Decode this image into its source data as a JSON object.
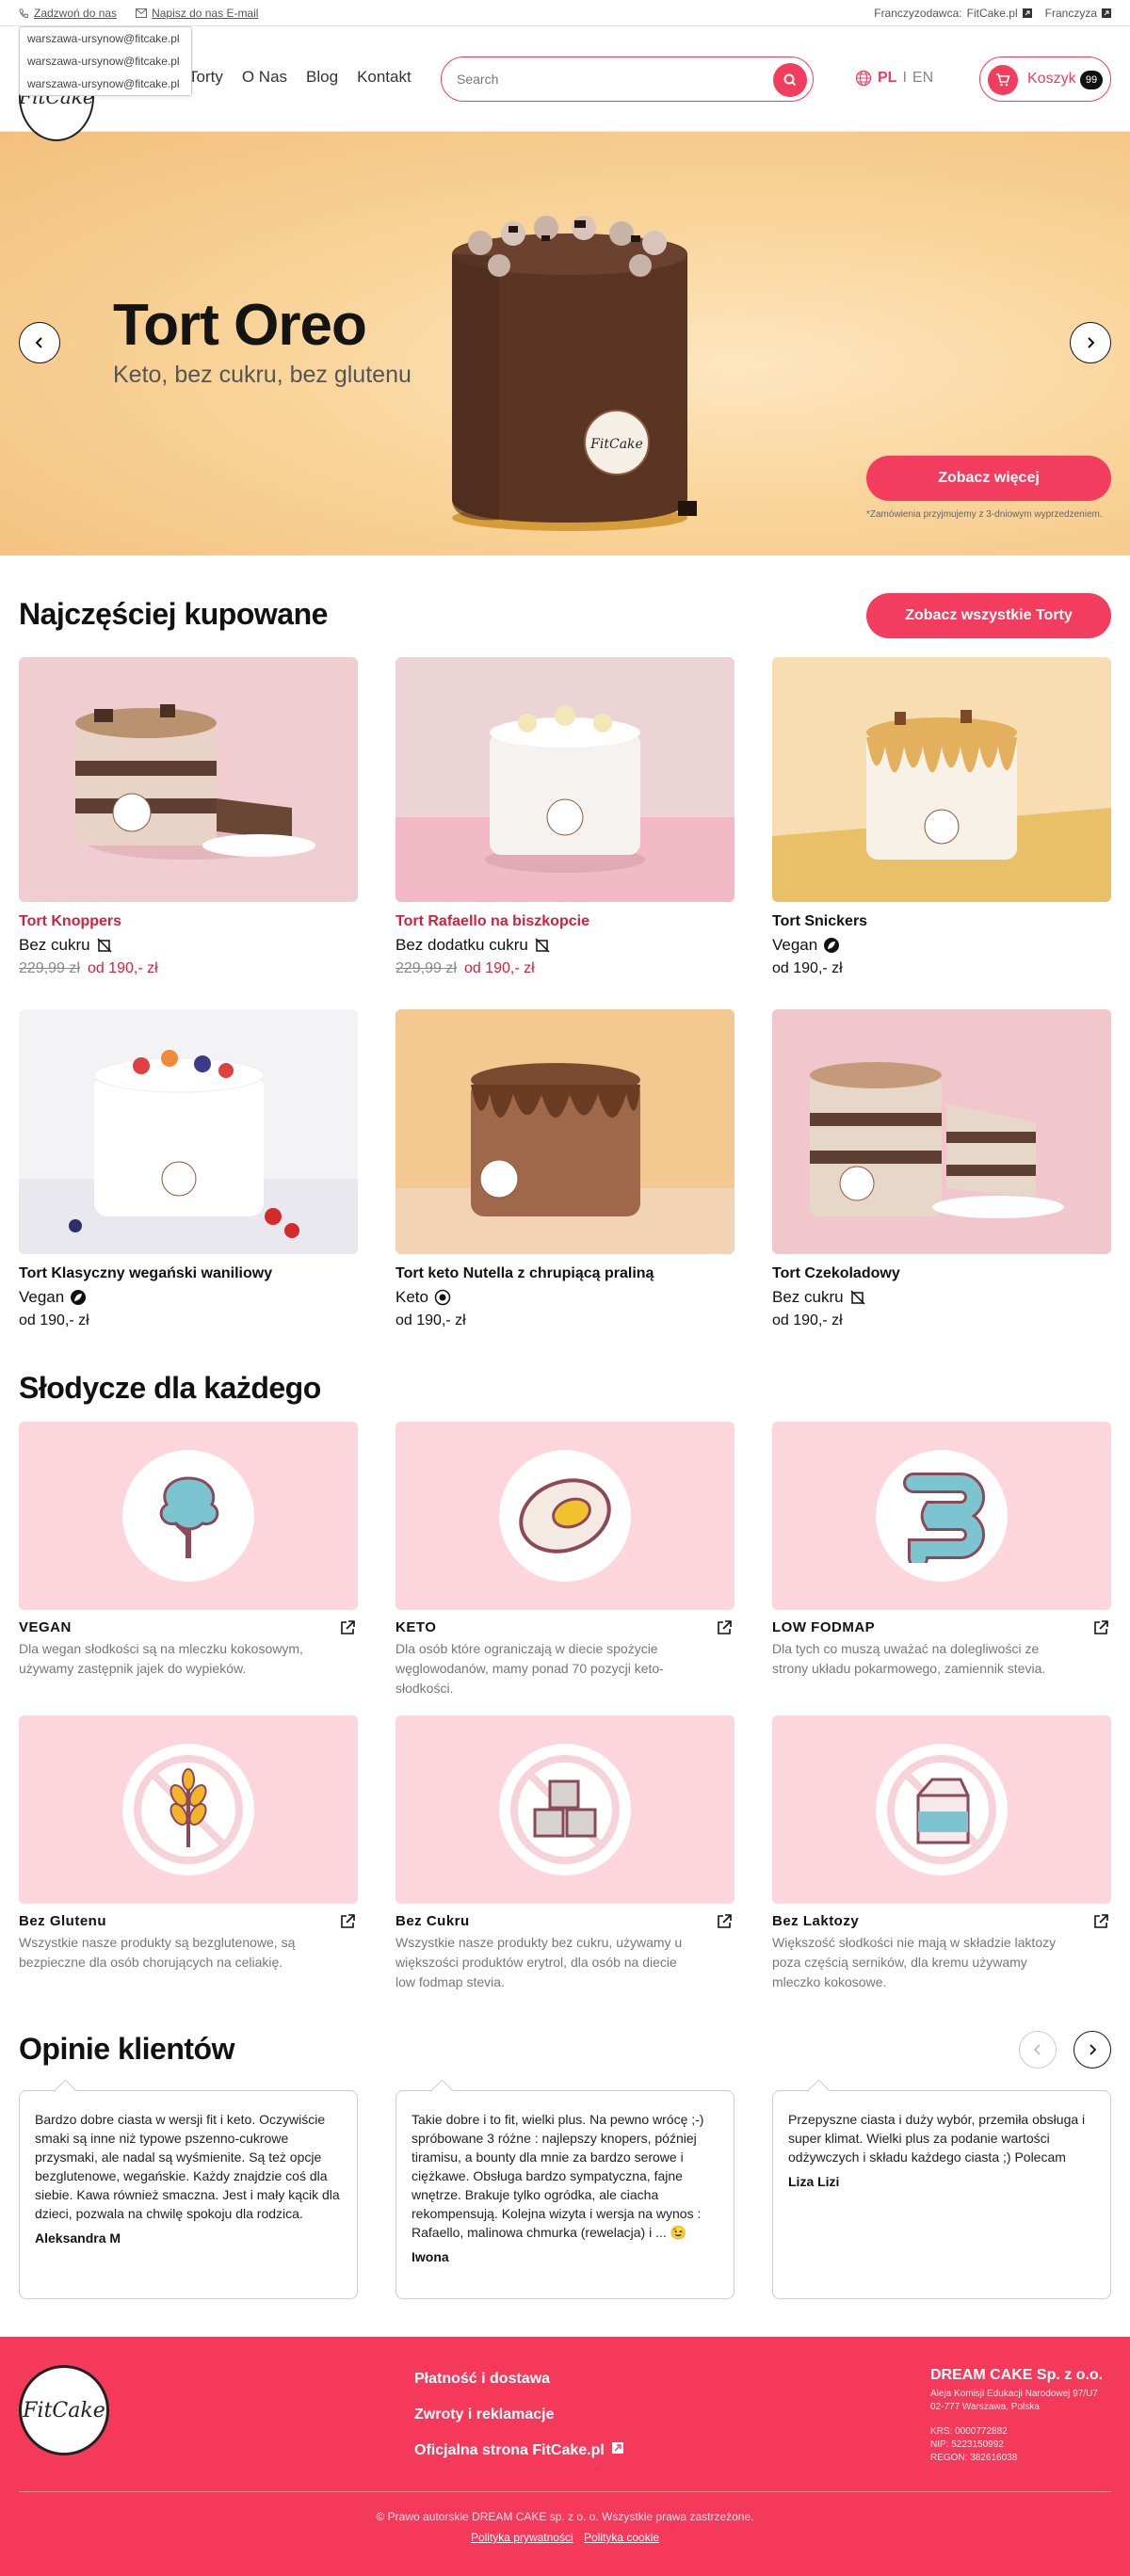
{
  "topbar": {
    "call": "Zadzwoń do nas",
    "email": "Napisz do nas E-mail",
    "franchisor_label": "Franczyzodawca:",
    "franchisor_link": "FitCake.pl",
    "franchise": "Franczyza",
    "dropdown": [
      "warszawa-ursynow@fitcake.pl",
      "warszawa-ursynow@fitcake.pl",
      "warszawa-ursynow@fitcake.pl"
    ]
  },
  "header": {
    "logo": "FitCake",
    "nav": [
      "Torty",
      "O Nas",
      "Blog",
      "Kontakt"
    ],
    "search_placeholder": "Search",
    "lang_active": "PL",
    "lang_sep": "I",
    "lang_other": "EN",
    "cart_label": "Koszyk",
    "cart_count": "99"
  },
  "hero": {
    "title": "Tort Oreo",
    "subtitle": "Keto, bez cukru, bez glutenu",
    "cta": "Zobacz więcej",
    "note": "*Zamówienia przyjmujemy z 3-dniowym wyprzedzeniem."
  },
  "popular": {
    "title": "Najczęściej kupowane",
    "cta": "Zobacz wszystkie Torty",
    "products": [
      {
        "name": "Tort Knoppers",
        "tag": "Bez cukru",
        "old_price": "229,99 zł",
        "price": "od 190,- zł"
      },
      {
        "name": "Tort Rafaello na biszkopcie",
        "tag": "Bez dodatku cukru",
        "old_price": "229,99 zł",
        "price": "od 190,- zł"
      },
      {
        "name": "Tort Snickers",
        "tag": "Vegan",
        "old_price": "",
        "price": "od 190,- zł"
      },
      {
        "name": "Tort Klasyczny wegański waniliowy",
        "tag": "Vegan",
        "old_price": "",
        "price": "od 190,- zł"
      },
      {
        "name": "Tort keto Nutella z chrupiącą praliną",
        "tag": "Keto",
        "old_price": "",
        "price": "od 190,- zł"
      },
      {
        "name": "Tort Czekoladowy",
        "tag": "Bez cukru",
        "old_price": "",
        "price": "od 190,- zł"
      }
    ]
  },
  "categories": {
    "title": "Słodycze dla każdego",
    "items": [
      {
        "title": "VEGAN",
        "desc": "Dla wegan słodkości są na mleczku kokosowym, używamy zastępnik jajek do wypieków."
      },
      {
        "title": "KETO",
        "desc": "Dla osób które ograniczają w diecie spożycie węglowodanów, mamy ponad 70 pozycji keto-słodkości."
      },
      {
        "title": "LOW FODMAP",
        "desc": "Dla tych co muszą uważać na dolegliwości ze strony układu pokarmowego, zamiennik stevia."
      },
      {
        "title": "Bez Glutenu",
        "desc": "Wszystkie nasze produkty są bezglutenowe, są bezpieczne dla osób chorujących na celiakię."
      },
      {
        "title": "Bez Cukru",
        "desc": "Wszystkie nasze produkty bez cukru, używamy u większości produktów erytrol, dla osób na diecie low fodmap stevia."
      },
      {
        "title": "Bez Laktozy",
        "desc": "Większość słodkości nie mają w składzie laktozy poza częścią serników, dla kremu używamy mleczko kokosowe."
      }
    ]
  },
  "reviews": {
    "title": "Opinie klientów",
    "items": [
      {
        "text": "Bardzo dobre ciasta w wersji fit i keto. Oczywiście smaki są inne niż typowe pszenno-cukrowe przysmaki, ale nadal są wyśmienite. Są też opcje bezglutenowe, wegańskie. Każdy znajdzie coś dla siebie. Kawa również smaczna. Jest i mały kącik dla dzieci, pozwala na chwilę spokoju dla rodzica.",
        "author": "Aleksandra M"
      },
      {
        "text": "Takie dobre i to fit, wielki plus. Na pewno wrócę ;-) spróbowane 3 różne : najlepszy knopers, później tiramisu, a bounty dla mnie za bardzo serowe i ciężkawe. Obsługa bardzo sympatyczna, fajne wnętrze. Brakuje tylko ogródka, ale ciacha rekompensują. Kolejna wizyta i wersja na wynos : Rafaello, malinowa chmurka (rewelacja) i ... 😉",
        "author": "Iwona"
      },
      {
        "text": "Przepyszne ciasta i duży wybór, przemiła obsługa i super klimat.  Wielki plus za podanie wartości odżywczych i składu każdego ciasta ;) Polecam",
        "author": "Liza Lizi"
      }
    ]
  },
  "footer": {
    "logo": "FitCake",
    "links": [
      "Płatność i dostawa",
      "Zwroty i reklamacje",
      "Oficjalna strona FitCake.pl"
    ],
    "company": "DREAM CAKE Sp. z o.o.",
    "address1": "Aleja Komisji Edukacji Narodowej 97/U7",
    "address2": "02-777 Warszawa, Polska",
    "krs": "KRS: 0000772882",
    "nip": "NIP: 5223150992",
    "regon": "REGON: 382616038",
    "copyright": "© Prawo autorskie DREAM CAKE sp. z o. o. Wszystkie prawa zastrzeżone.",
    "privacy": "Polityka prywatności",
    "cookies": "Polityka cookie"
  },
  "colors": {
    "accent": "#f23d5e",
    "category_bg": "#fcd5dd",
    "footer_bg": "#f4395a"
  }
}
